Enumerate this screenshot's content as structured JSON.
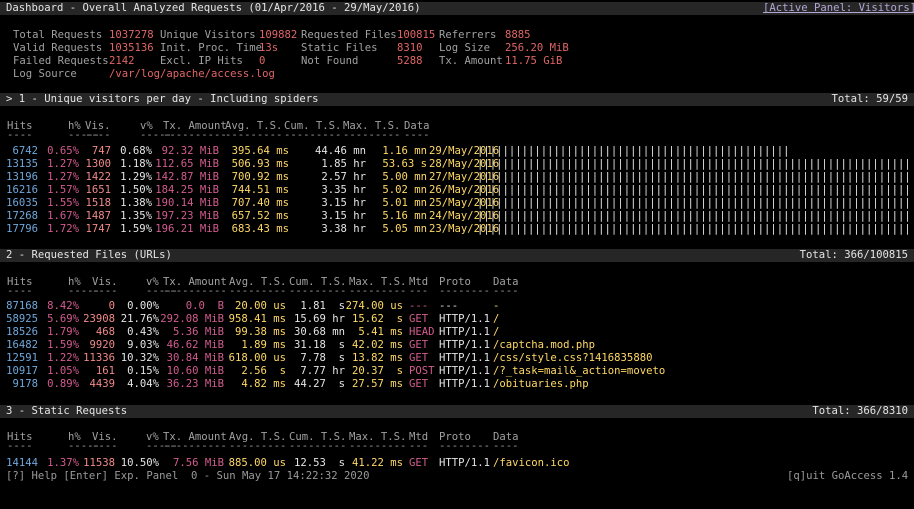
{
  "header": {
    "title": "Dashboard - Overall Analyzed Requests (01/Apr/2016 - 29/May/2016)",
    "active_panel": "[Active Panel: Visitors]"
  },
  "overall": [
    [
      {
        "label": "Total Requests",
        "value": "1037278"
      },
      {
        "label": "Unique Visitors",
        "value": "109882"
      },
      {
        "label": "Requested Files",
        "value": "100815"
      },
      {
        "label": "Referrers",
        "value": "8885"
      }
    ],
    [
      {
        "label": "Valid Requests",
        "value": "1035136"
      },
      {
        "label": "Init. Proc. Time",
        "value": "13s"
      },
      {
        "label": "Static Files",
        "value": "8310"
      },
      {
        "label": "Log Size",
        "value": "256.20 MiB"
      }
    ],
    [
      {
        "label": "Failed Requests",
        "value": "2142"
      },
      {
        "label": "Excl. IP Hits",
        "value": "0"
      },
      {
        "label": "Not Found",
        "value": "5288"
      },
      {
        "label": "Tx. Amount",
        "value": "11.75 GiB"
      }
    ],
    [
      {
        "label": "Log Source",
        "value": "/var/log/apache/access.log"
      }
    ]
  ],
  "panels": {
    "visitors": {
      "title": "> 1 - Unique visitors per day - Including spiders",
      "total": "Total: 59/59",
      "headers": {
        "hits": "Hits",
        "hp": "h%",
        "vis": "Vis.",
        "vp": "v%",
        "tx": "Tx. Amount",
        "avg": "Avg. T.S.",
        "cum": "Cum. T.S.",
        "max": "Max. T.S.",
        "data": "Data"
      },
      "dashes": {
        "hits": "----",
        "hp": "-----",
        "vis": "----",
        "vp": "-----",
        "tx": "----------",
        "avg": "---------",
        "cum": "---------",
        "max": "---------",
        "data": "----"
      },
      "rows": [
        {
          "hits": "6742",
          "hp": "0.65%",
          "vis": "747",
          "vp": "0.68%",
          "tx": "92.32 MiB",
          "avg": "395.64 ms",
          "cum": "44.46 mn",
          "max": "1.16 mn",
          "data": "29/May/2016",
          "bars": "|||||||||||||||||||||||||||||||||||||||||||||||||"
        },
        {
          "hits": "13135",
          "hp": "1.27%",
          "vis": "1300",
          "vp": "1.18%",
          "tx": "112.65 MiB",
          "avg": "506.93 ms",
          "cum": "1.85 hr",
          "max": "53.63 s",
          "data": "28/May/2016",
          "bars": "||||||||||||||||||||||||||||||||||||||||||||||||||||||||||||||||||||||||||||||||||||||||||||||||||||||||||||||||||||||||"
        },
        {
          "hits": "13196",
          "hp": "1.27%",
          "vis": "1422",
          "vp": "1.29%",
          "tx": "142.87 MiB",
          "avg": "700.92 ms",
          "cum": "2.57 hr",
          "max": "5.00 mn",
          "data": "27/May/2016",
          "bars": "|||||||||||||||||||||||||||||||||||||||||||||||||||||||||||||||||||||||||||||||||||||||||||||||||||||||||||||||||||||||||||"
        },
        {
          "hits": "16216",
          "hp": "1.57%",
          "vis": "1651",
          "vp": "1.50%",
          "tx": "184.25 MiB",
          "avg": "744.51 ms",
          "cum": "3.35 hr",
          "max": "5.02 mn",
          "data": "26/May/2016",
          "bars": "|||||||||||||||||||||||||||||||||||||||||||||||||||||||||||||||||||||||||||||||||||||||||||||||||||||||||||||||||||||||||||||||||||||||||||||||||||||||"
        },
        {
          "hits": "16035",
          "hp": "1.55%",
          "vis": "1518",
          "vp": "1.38%",
          "tx": "190.14 MiB",
          "avg": "707.40 ms",
          "cum": "3.15 hr",
          "max": "5.01 mn",
          "data": "25/May/2016",
          "bars": "||||||||||||||||||||||||||||||||||||||||||||||||||||||||||||||||||||||||||||||||||||||||||||||||||||||||||||||||||||||||||||||||||||||||||||||||||||||"
        },
        {
          "hits": "17268",
          "hp": "1.67%",
          "vis": "1487",
          "vp": "1.35%",
          "tx": "197.23 MiB",
          "avg": "657.52 ms",
          "cum": "3.15 hr",
          "max": "5.16 mn",
          "data": "24/May/2016",
          "bars": "|||||||||||||||||||||||||||||||||||||||||||||||||||||||||||||||||||||||||||||||||||||||||||||||||||||||||||||||||||||||||||||||||||||||||||||||||||||||||||||||"
        },
        {
          "hits": "17796",
          "hp": "1.72%",
          "vis": "1747",
          "vp": "1.59%",
          "tx": "196.21 MiB",
          "avg": "683.43 ms",
          "cum": "3.38 hr",
          "max": "5.05 mn",
          "data": "23/May/2016",
          "bars": "||||||||||||||||||||||||||||||||||||||||||||||||||||||||||||||||||||||||||||||||||||||||||||||||||||||||||||||||||||||||||||||||||||||||||||||||||||||||||||||||||||"
        }
      ]
    },
    "requests": {
      "title": "2 - Requested Files (URLs)",
      "total": "Total: 366/100815",
      "headers": {
        "hits": "Hits",
        "hp": "h%",
        "vis": "Vis.",
        "vp": "v%",
        "tx": "Tx. Amount",
        "avg": "Avg. T.S.",
        "cum": "Cum. T.S.",
        "max": "Max. T.S.",
        "mtd": "Mtd",
        "proto": "Proto",
        "data": "Data"
      },
      "dashes": {
        "hits": "----",
        "hp": "-----",
        "vis": "----",
        "vp": "-----",
        "tx": "----------",
        "avg": "---------",
        "cum": "---------",
        "max": "---------",
        "mtd": "---",
        "proto": "--------",
        "data": "----"
      },
      "rows": [
        {
          "hits": "87168",
          "hp": "8.42%",
          "vis": "0",
          "vp": "0.00%",
          "tx": "0.0  B",
          "avg": "20.00 us",
          "cum": "1.81  s",
          "max": "274.00 us",
          "mtd": "---",
          "proto": "---",
          "data": "-"
        },
        {
          "hits": "58925",
          "hp": "5.69%",
          "vis": "23908",
          "vp": "21.76%",
          "tx": "292.08 MiB",
          "avg": "958.41 ms",
          "cum": "15.69 hr",
          "max": "15.62  s",
          "mtd": "GET",
          "proto": "HTTP/1.1",
          "data": "/"
        },
        {
          "hits": "18526",
          "hp": "1.79%",
          "vis": "468",
          "vp": "0.43%",
          "tx": "5.36 MiB",
          "avg": "99.38 ms",
          "cum": "30.68 mn",
          "max": "5.41 ms",
          "mtd": "HEAD",
          "proto": "HTTP/1.1",
          "data": "/"
        },
        {
          "hits": "16482",
          "hp": "1.59%",
          "vis": "9920",
          "vp": "9.03%",
          "tx": "46.62 MiB",
          "avg": "1.89 ms",
          "cum": "31.18  s",
          "max": "42.02 ms",
          "mtd": "GET",
          "proto": "HTTP/1.1",
          "data": "/captcha.mod.php"
        },
        {
          "hits": "12591",
          "hp": "1.22%",
          "vis": "11336",
          "vp": "10.32%",
          "tx": "30.84 MiB",
          "avg": "618.00 us",
          "cum": "7.78  s",
          "max": "13.82 ms",
          "mtd": "GET",
          "proto": "HTTP/1.1",
          "data": "/css/style.css?1416835880"
        },
        {
          "hits": "10917",
          "hp": "1.05%",
          "vis": "161",
          "vp": "0.15%",
          "tx": "10.60 MiB",
          "avg": "2.56  s",
          "cum": "7.77 hr",
          "max": "20.37  s",
          "mtd": "POST",
          "proto": "HTTP/1.1",
          "data": "/?_task=mail&_action=moveto"
        },
        {
          "hits": "9178",
          "hp": "0.89%",
          "vis": "4439",
          "vp": "4.04%",
          "tx": "36.23 MiB",
          "avg": "4.82 ms",
          "cum": "44.27  s",
          "max": "27.57 ms",
          "mtd": "GET",
          "proto": "HTTP/1.1",
          "data": "/obituaries.php"
        }
      ]
    },
    "static": {
      "title": "3 - Static Requests",
      "total": "Total: 366/8310",
      "headers": {
        "hits": "Hits",
        "hp": "h%",
        "vis": "Vis.",
        "vp": "v%",
        "tx": "Tx. Amount",
        "avg": "Avg. T.S.",
        "cum": "Cum. T.S.",
        "max": "Max. T.S.",
        "mtd": "Mtd",
        "proto": "Proto",
        "data": "Data"
      },
      "dashes": {
        "hits": "----",
        "hp": "-----",
        "vis": "----",
        "vp": "-----",
        "tx": "----------",
        "avg": "---------",
        "cum": "---------",
        "max": "---------",
        "mtd": "---",
        "proto": "--------",
        "data": "----"
      },
      "rows": [
        {
          "hits": "14144",
          "hp": "1.37%",
          "vis": "11538",
          "vp": "10.50%",
          "tx": "7.56 MiB",
          "avg": "885.00 us",
          "cum": "12.53  s",
          "max": "41.22 ms",
          "mtd": "GET",
          "proto": "HTTP/1.1",
          "data": "/favicon.ico"
        }
      ]
    }
  },
  "footer": {
    "left": "[?] Help [Enter] Exp. Panel  0 - Sun May 17 14:22:32 2020",
    "right": "[q]uit GoAccess 1.4"
  }
}
